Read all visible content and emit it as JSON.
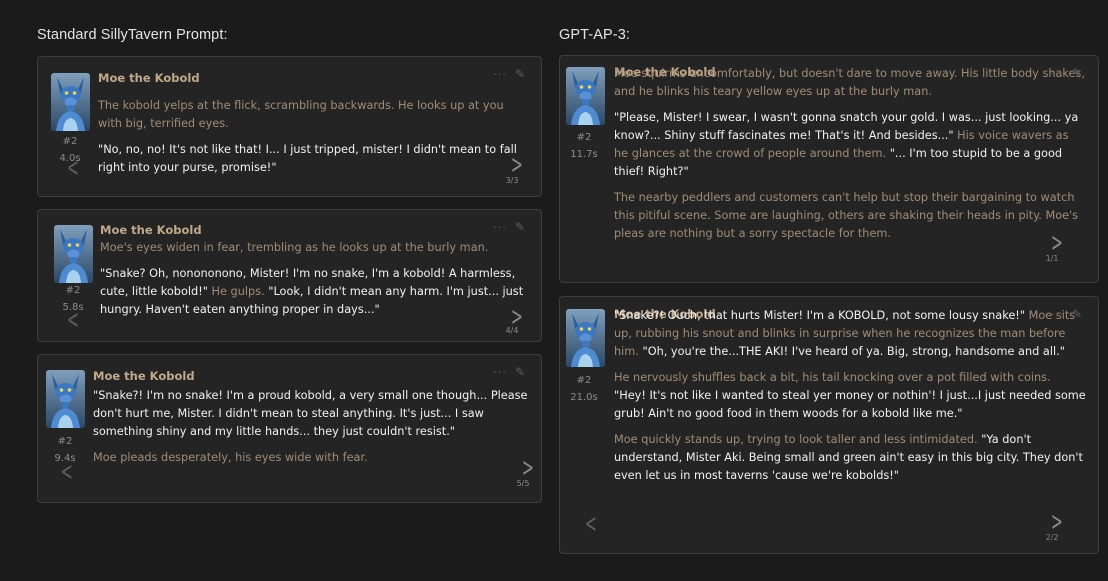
{
  "left_column": {
    "title": "Standard SillyTavern Prompt:",
    "messages": [
      {
        "character": "Moe the Kobold",
        "id": "#2",
        "time": "4.0s",
        "swipe": "3/3",
        "paragraphs": [
          [
            {
              "type": "narr",
              "text": "The kobold yelps at the flick, scrambling backwards. He looks up at you with big, terrified eyes."
            }
          ],
          [
            {
              "type": "dlg",
              "text": "\"No, no, no! It's not like that! I... I just tripped, mister! I didn't mean to fall right into your purse, promise!\""
            }
          ]
        ]
      },
      {
        "character": "Moe the Kobold",
        "id": "#2",
        "time": "5.8s",
        "swipe": "4/4",
        "paragraphs": [
          [
            {
              "type": "narr",
              "text": "Moe's eyes widen in fear, trembling as he looks up at the burly man."
            }
          ],
          [
            {
              "type": "dlg",
              "text": "\"Snake? Oh, nonononono, Mister! I'm no snake, I'm a kobold! A harmless, cute, little kobold!\""
            },
            {
              "type": "narr",
              "text": " He gulps. "
            },
            {
              "type": "dlg",
              "text": "\"Look, I didn't mean any harm. I'm just... just hungry. Haven't eaten anything proper in days...\""
            }
          ]
        ]
      },
      {
        "character": "Moe the Kobold",
        "id": "#2",
        "time": "9.4s",
        "swipe": "5/5",
        "paragraphs": [
          [
            {
              "type": "dlg",
              "text": "\"Snake?! I'm no snake! I'm a proud kobold, a very small one though... Please don't hurt me, Mister. I didn't mean to steal anything. It's just... I saw something shiny and my little hands... they just couldn't resist.\""
            }
          ],
          [
            {
              "type": "narr",
              "text": "Moe pleads desperately, his eyes wide with fear."
            }
          ]
        ]
      }
    ]
  },
  "right_column": {
    "title": "GPT-AP-3:",
    "messages": [
      {
        "character": "Moe the Kobold",
        "id": "#2",
        "time": "11.7s",
        "swipe": "1/1",
        "paragraphs": [
          [
            {
              "type": "narr",
              "text": "Moe squirms uncomfortably, but doesn't dare to move away. His little body shakes, and he blinks his teary yellow eyes up at the burly man."
            }
          ],
          [
            {
              "type": "dlg",
              "text": "\"Please, Mister! I swear, I wasn't gonna snatch your gold. I was... just looking... ya know?... Shiny stuff fascinates me! That's it! And besides...\""
            },
            {
              "type": "narr",
              "text": " His voice wavers as he glances at the crowd of people around them. "
            },
            {
              "type": "dlg",
              "text": "\"... I'm too stupid to be a good thief! Right?\""
            }
          ],
          [
            {
              "type": "narr",
              "text": "The nearby peddlers and customers can't help but stop their bargaining to watch this pitiful scene. Some are laughing, others are shaking their heads in pity. Moe's pleas are nothing but a sorry spectacle for them."
            }
          ]
        ]
      },
      {
        "character": "Moe the Kobold",
        "id": "#2",
        "time": "21.0s",
        "swipe": "2/2",
        "paragraphs": [
          [
            {
              "type": "dlg",
              "text": "\"Snake?! Ouch, that hurts Mister! I'm a KOBOLD, not some lousy snake!\""
            },
            {
              "type": "narr",
              "text": " Moe sits up, rubbing his snout and blinks in surprise when he recognizes the man before him. "
            },
            {
              "type": "dlg",
              "text": "\"Oh, you're the...THE AKI! I've heard of ya. Big, strong, handsome and all.\""
            }
          ],
          [
            {
              "type": "narr",
              "text": "He nervously shuffles back a bit, his tail knocking over a pot filled with coins. "
            },
            {
              "type": "dlg",
              "text": "\"Hey! It's not like I wanted to steal yer money or nothin'! I just...I just needed some grub! Ain't no good food in them woods for a kobold like me.\""
            }
          ],
          [
            {
              "type": "narr",
              "text": "Moe quickly stands up, trying to look taller and less intimidated. "
            },
            {
              "type": "dlg",
              "text": "\"Ya don't understand, Mister Aki. Being small and green ain't easy in this big city. They don't even let us in most taverns 'cause we're kobolds!\""
            }
          ]
        ]
      }
    ]
  },
  "icons": {
    "more": "ellipsis-icon",
    "edit": "pencil-icon",
    "swipe_left": "chevron-left-icon",
    "swipe_right": "chevron-right-icon"
  },
  "colors": {
    "background": "#1b1b1b",
    "card": "#242424",
    "name": "#c2a98a",
    "narration": "#a08c75",
    "dialogue": "#f2f2f2"
  }
}
